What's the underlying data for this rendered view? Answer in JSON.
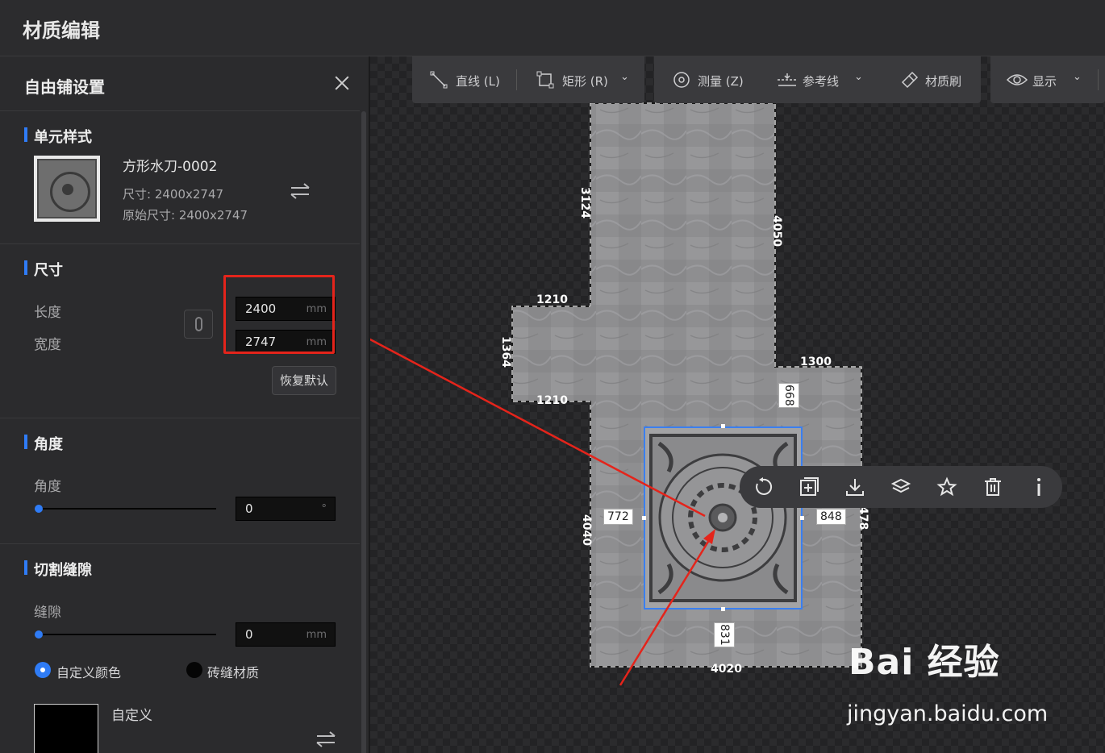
{
  "app": {
    "title": "材质编辑"
  },
  "panel": {
    "title": "自由铺设置",
    "unit_style": {
      "heading": "单元样式",
      "material_name": "方形水刀-0002",
      "size": "尺寸: 2400x2747",
      "original_size": "原始尺寸: 2400x2747"
    },
    "dimensions": {
      "heading": "尺寸",
      "length_label": "长度",
      "width_label": "宽度",
      "length_value": "2400",
      "width_value": "2747",
      "unit": "mm",
      "reset_label": "恢复默认"
    },
    "angle": {
      "heading": "角度",
      "label": "角度",
      "value": "0",
      "unit": "°",
      "slider_fraction": 0
    },
    "cut_gap": {
      "heading": "切割缝隙",
      "label": "缝隙",
      "value": "0",
      "unit": "mm",
      "slider_fraction": 0,
      "option_custom_color": "自定义颜色",
      "option_joint_material": "砖缝材质",
      "selected_option": "自定义颜色",
      "custom_label": "自定义",
      "custom_color": "#000000"
    }
  },
  "toolbar": {
    "line": "直线 (L)",
    "rect": "矩形 (R)",
    "measure": "测量 (Z)",
    "guide": "参考线",
    "brush": "材质刷",
    "display": "显示"
  },
  "floating_toolbar": {
    "icons": [
      "rotate-icon",
      "add-icon",
      "download-icon",
      "layers-icon",
      "star-icon",
      "delete-icon",
      "info-icon"
    ]
  },
  "dimensions_on_plan": {
    "top_left_vertical": "3124",
    "top_right_vertical": "4050",
    "arm_top": "1210",
    "arm_left": "1364",
    "arm_bottom": "1210",
    "right_step": "1300",
    "gap_top": "668",
    "gap_left": "772",
    "gap_right": "848",
    "right_vertical": "478",
    "left_vertical": "4040",
    "gap_bottom": "831",
    "bottom": "4020"
  },
  "watermark": {
    "logo": "Bai 经验",
    "url": "jingyan.baidu.com"
  },
  "colors": {
    "accent": "#2f7cf6",
    "highlight": "#e4241b"
  }
}
